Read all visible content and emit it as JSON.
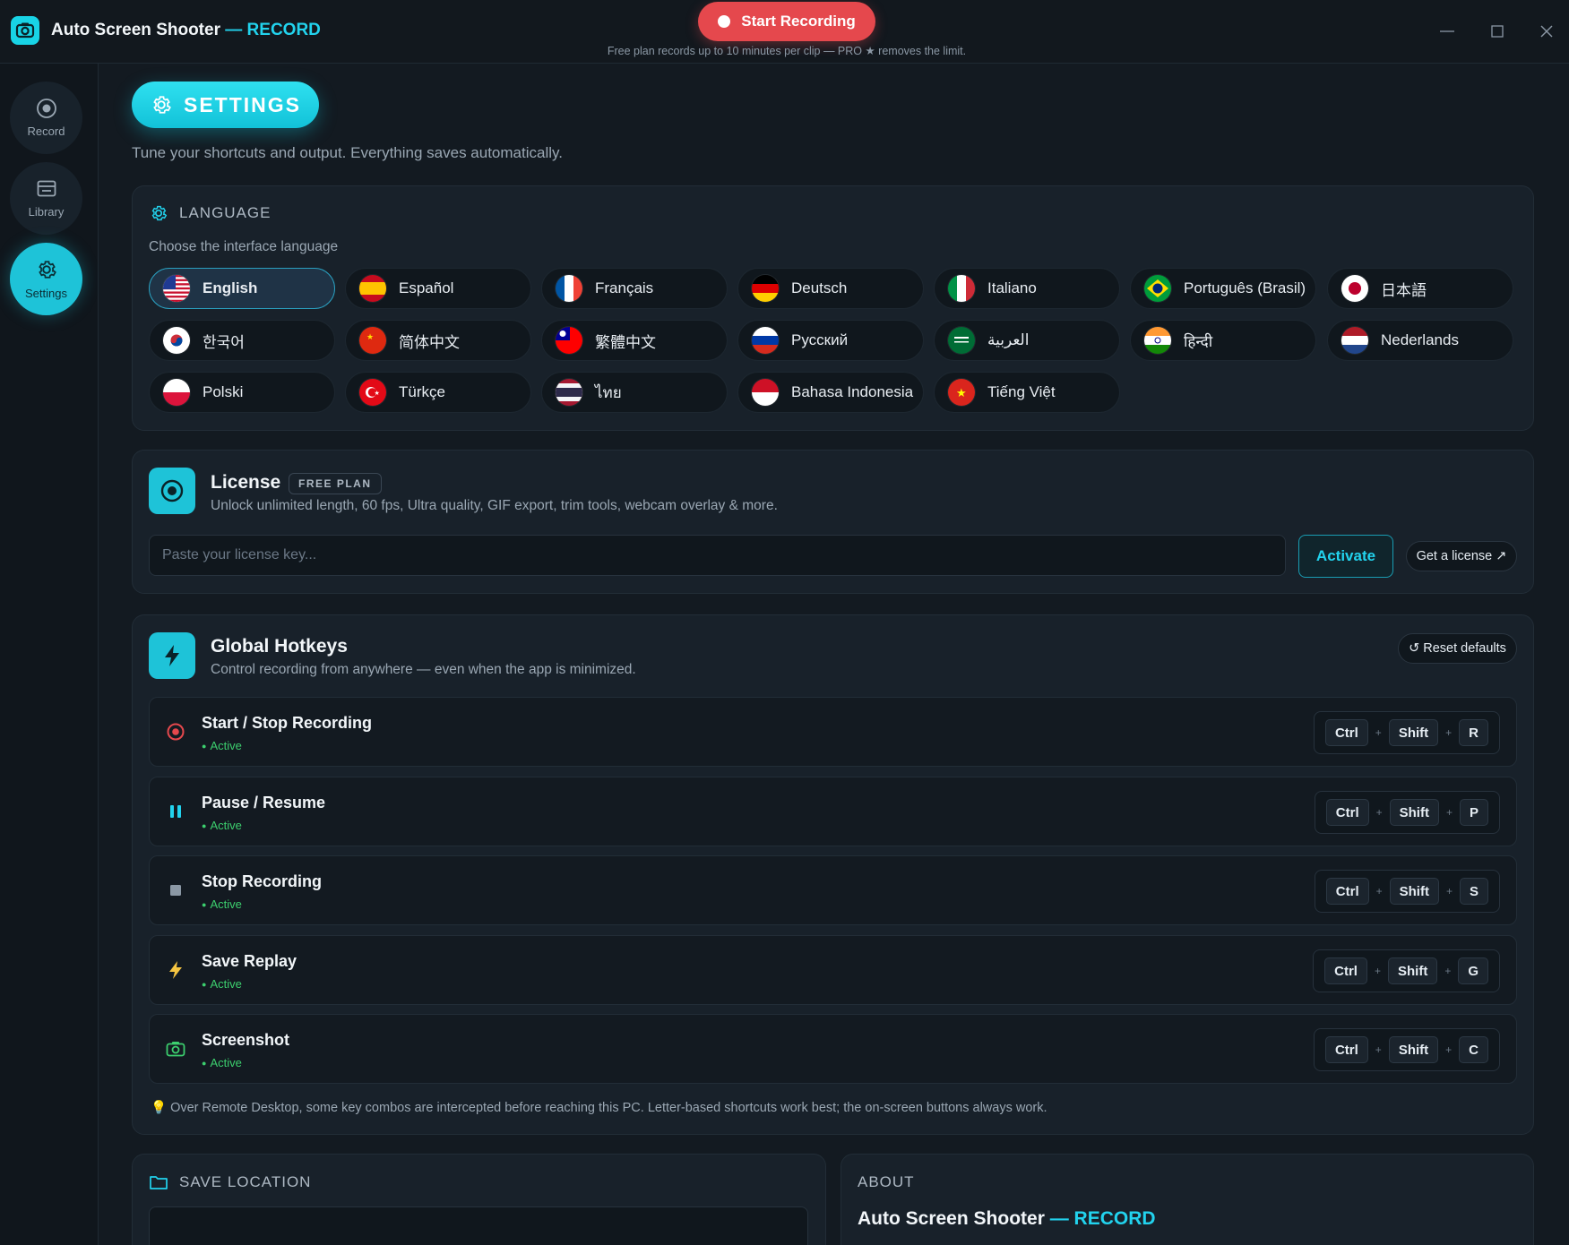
{
  "titlebar": {
    "app_name": "Auto Screen Shooter",
    "app_sep": " — ",
    "app_suffix": "RECORD",
    "start_button": "Start Recording",
    "free_note": "Free plan records up to 10 minutes per clip — PRO ★ removes the limit."
  },
  "sidebar": {
    "items": [
      {
        "label": "Record",
        "icon": "record-icon"
      },
      {
        "label": "Library",
        "icon": "library-icon"
      },
      {
        "label": "Settings",
        "icon": "gear-icon",
        "active": true
      }
    ]
  },
  "page": {
    "title": "SETTINGS",
    "subtitle": "Tune your shortcuts and output. Everything saves automatically."
  },
  "language": {
    "heading": "LANGUAGE",
    "description": "Choose the interface language",
    "selected": "English",
    "options": [
      {
        "label": "English",
        "flag": "us"
      },
      {
        "label": "Español",
        "flag": "es"
      },
      {
        "label": "Français",
        "flag": "fr"
      },
      {
        "label": "Deutsch",
        "flag": "de"
      },
      {
        "label": "Italiano",
        "flag": "it"
      },
      {
        "label": "Português (Brasil)",
        "flag": "br"
      },
      {
        "label": "日本語",
        "flag": "jp"
      },
      {
        "label": "한국어",
        "flag": "kr"
      },
      {
        "label": "简体中文",
        "flag": "cn"
      },
      {
        "label": "繁體中文",
        "flag": "tw"
      },
      {
        "label": "Русский",
        "flag": "ru"
      },
      {
        "label": "العربية",
        "flag": "sa"
      },
      {
        "label": "हिन्दी",
        "flag": "in"
      },
      {
        "label": "Nederlands",
        "flag": "nl"
      },
      {
        "label": "Polski",
        "flag": "pl"
      },
      {
        "label": "Türkçe",
        "flag": "tr"
      },
      {
        "label": "ไทย",
        "flag": "th"
      },
      {
        "label": "Bahasa Indonesia",
        "flag": "id"
      },
      {
        "label": "Tiếng Việt",
        "flag": "vn"
      }
    ]
  },
  "license": {
    "title": "License",
    "badge": "FREE PLAN",
    "description": "Unlock unlimited length, 60 fps, Ultra quality, GIF export, trim tools, webcam overlay & more.",
    "input_placeholder": "Paste your license key...",
    "input_value": "",
    "activate_label": "Activate",
    "get_license_label": "Get a license ↗"
  },
  "hotkeys": {
    "title": "Global Hotkeys",
    "description": "Control recording from anywhere — even when the app is minimized.",
    "reset_label": "↺ Reset defaults",
    "plus": "+",
    "items": [
      {
        "name": "Start / Stop Recording",
        "status": "Active",
        "icon": "record-icon",
        "keys": [
          "Ctrl",
          "Shift",
          "R"
        ]
      },
      {
        "name": "Pause / Resume",
        "status": "Active",
        "icon": "pause-icon",
        "keys": [
          "Ctrl",
          "Shift",
          "P"
        ]
      },
      {
        "name": "Stop Recording",
        "status": "Active",
        "icon": "stop-icon",
        "keys": [
          "Ctrl",
          "Shift",
          "S"
        ]
      },
      {
        "name": "Save Replay",
        "status": "Active",
        "icon": "bolt-icon",
        "keys": [
          "Ctrl",
          "Shift",
          "G"
        ]
      },
      {
        "name": "Screenshot",
        "status": "Active",
        "icon": "camera-icon",
        "keys": [
          "Ctrl",
          "Shift",
          "C"
        ]
      }
    ],
    "note": "Over Remote Desktop, some key combos are intercepted before reaching this PC. Letter-based shortcuts work best; the on-screen buttons always work."
  },
  "save_location": {
    "heading": "SAVE LOCATION"
  },
  "about": {
    "heading": "ABOUT",
    "name": "Auto Screen Shooter",
    "sep": " — ",
    "suffix": "RECORD"
  },
  "colors": {
    "accent": "#22d3ee",
    "record_red": "#e5484d",
    "status_green": "#3ccf6e",
    "background": "#131a21",
    "card": "#18212a"
  }
}
